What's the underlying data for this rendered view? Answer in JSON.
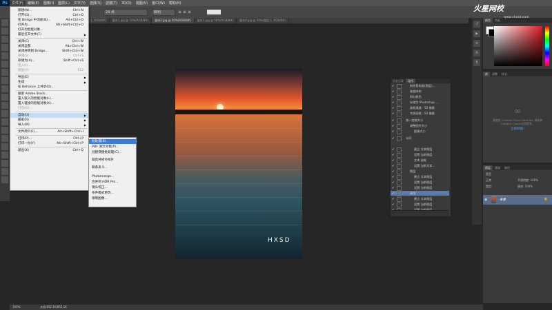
{
  "menubar": {
    "logo": "Ps",
    "items": [
      "文件(F)",
      "编辑(E)",
      "图像(I)",
      "图层(L)",
      "文字(Y)",
      "选择(S)",
      "滤镜(T)",
      "3D(D)",
      "视图(V)",
      "窗口(W)",
      "帮助(H)"
    ]
  },
  "options": {
    "size_value": "24 点",
    "style_value": "犀利"
  },
  "tabs": [
    "HXSD-2.jpg @ 50%(RGB/8#)",
    "未标题-1 @ 66.7%(图层 1, RGB/8#)",
    "副本1.jpg @ 50%(RGB/8#)",
    "副本2.jpg @ 50%(RGB/8#)",
    "副本3.jpg @ 50%(RGB/8#)",
    "副本4.jpg @ 50%(图层 1, RGB/8#)"
  ],
  "file_menu": {
    "items": [
      {
        "label": "新建(N)...",
        "shortcut": "Ctrl+N"
      },
      {
        "label": "打开(O)...",
        "shortcut": "Ctrl+O"
      },
      {
        "label": "在 Bridge 中浏览(B)...",
        "shortcut": "Alt+Ctrl+O"
      },
      {
        "label": "打开为...",
        "shortcut": "Alt+Shift+Ctrl+O"
      },
      {
        "label": "打开为智能对象...",
        "shortcut": ""
      },
      {
        "label": "最近打开文件(T)",
        "shortcut": ""
      },
      {
        "label": "关闭(C)",
        "shortcut": "Ctrl+W"
      },
      {
        "label": "关闭全部",
        "shortcut": "Alt+Ctrl+W"
      },
      {
        "label": "关闭并转到 Bridge...",
        "shortcut": "Shift+Ctrl+W"
      },
      {
        "label": "存储(S)",
        "shortcut": "Ctrl+S"
      },
      {
        "label": "存储为(A)...",
        "shortcut": "Shift+Ctrl+S"
      },
      {
        "label": "签入(I)...",
        "shortcut": ""
      },
      {
        "label": "恢复(V)",
        "shortcut": "F12"
      },
      {
        "label": "导出(E)",
        "shortcut": ""
      },
      {
        "label": "生成",
        "shortcut": ""
      },
      {
        "label": "在 Behance 上共享(D)...",
        "shortcut": ""
      },
      {
        "label": "搜索 Adobe Stock...",
        "shortcut": ""
      },
      {
        "label": "置入嵌入的智能对象(L)...",
        "shortcut": ""
      },
      {
        "label": "置入链接的智能对象(K)...",
        "shortcut": ""
      },
      {
        "label": "打包(G)...",
        "shortcut": ""
      },
      {
        "label": "自动(U)",
        "shortcut": ""
      },
      {
        "label": "脚本(R)",
        "shortcut": ""
      },
      {
        "label": "导入(M)",
        "shortcut": ""
      },
      {
        "label": "文件简介(F)...",
        "shortcut": "Alt+Shift+Ctrl+I"
      },
      {
        "label": "打印(P)...",
        "shortcut": "Ctrl+P"
      },
      {
        "label": "打印一份(Y)",
        "shortcut": "Alt+Shift+Ctrl+P"
      },
      {
        "label": "退出(X)",
        "shortcut": "Ctrl+Q"
      }
    ]
  },
  "submenu": {
    "items": [
      "批处理(B)...",
      "PDF 演示文稿(P)...",
      "创建快捷批处理(C)...",
      "裁剪并修齐照片",
      "联系表 II...",
      "Photomerge...",
      "合并到 HDR Pro...",
      "镜头校正...",
      "条件模式更改...",
      "限制图像..."
    ]
  },
  "actions_panel": {
    "tabs": [
      "历史记录",
      "动作"
    ],
    "rows": [
      "制作剪贴画(图层)...",
      "渐变映射",
      "四分颜色",
      "存储为 Photoshop ...",
      "画框通道 - 50 像素",
      "木质画框 - 50 像素",
      "统一控制大小",
      "调整图片大小",
      "图像大小",
      "水印",
      "建立 文本图层",
      "设置 当前图层",
      "文本 选框",
      "设置 当前文本...",
      "图层",
      "建立 文本图层",
      "设置 当前图层",
      "设置 当前图层",
      "调用",
      "建立 文本图层",
      "设置 当前图层",
      "设置 当前图层"
    ]
  },
  "color_panel": {
    "tabs": [
      "颜色",
      "色板"
    ]
  },
  "library_panel": {
    "tabs": [
      "库",
      "调整",
      "样式"
    ],
    "message": "要使用 Creative Cloud Libraries, 请安装 Creative Cloud 应用程序。",
    "link": "立即获取!"
  },
  "layers_panel": {
    "tabs": [
      "图层",
      "通道",
      "路径"
    ],
    "kind": "类型",
    "blend": "正常",
    "opacity_label": "不透明度: 100%",
    "lock_label": "锁定:",
    "fill_label": "填充: 100%",
    "layer_name": "背景"
  },
  "canvas": {
    "watermark": "HXSD"
  },
  "status": {
    "zoom": "100%",
    "doc": "文档:852.1K/852.1K"
  },
  "brand": {
    "name": "火星网校",
    "url": "www.vhxsd.com"
  }
}
